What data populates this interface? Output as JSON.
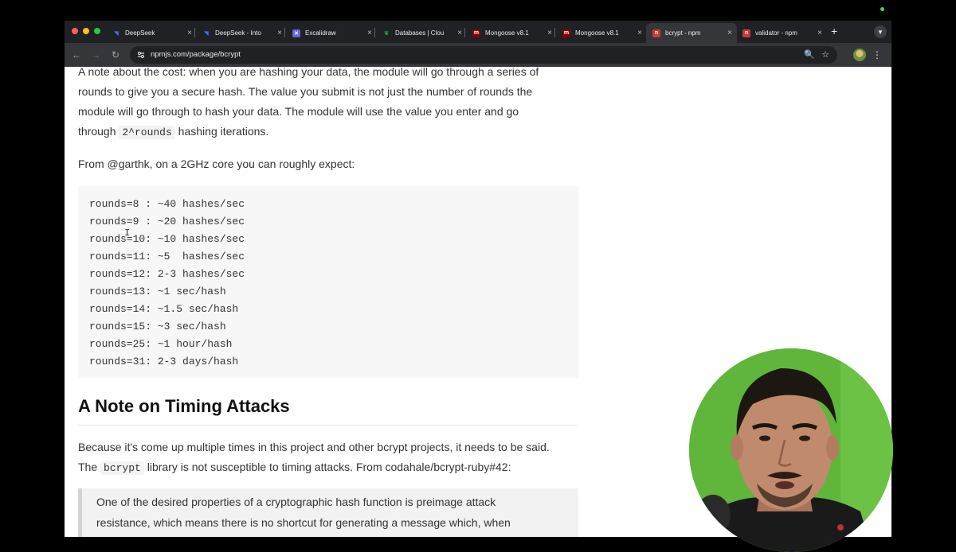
{
  "browser": {
    "tabs": [
      {
        "title": "DeepSeek",
        "icon": "deepseek-whale-icon",
        "color": "#4d6bfe",
        "active": false
      },
      {
        "title": "DeepSeek - Into",
        "icon": "deepseek-whale-icon",
        "color": "#4d6bfe",
        "active": false
      },
      {
        "title": "Excalidraw",
        "icon": "excalidraw-icon",
        "color": "#6965db",
        "active": false
      },
      {
        "title": "Databases | Clou",
        "icon": "mongodb-leaf-icon",
        "color": "#13aa52",
        "active": false
      },
      {
        "title": "Mongoose v8.1",
        "icon": "mongoose-icon",
        "color": "#800",
        "active": false
      },
      {
        "title": "Mongoose v8.1",
        "icon": "mongoose-icon",
        "color": "#800",
        "active": false
      },
      {
        "title": "bcrypt - npm",
        "icon": "npm-icon",
        "color": "#cb3837",
        "active": true
      },
      {
        "title": "validator - npm",
        "icon": "npm-icon",
        "color": "#cb3837",
        "active": false
      }
    ],
    "tab_close_glyph": "×",
    "new_tab_glyph": "+",
    "url": "npmjs.com/package/bcrypt"
  },
  "content": {
    "para1": {
      "line1": "A note about the cost: when you are hashing your data, the module will go through a series of",
      "line2": "rounds to give you a secure hash. The value you submit is not just the number of rounds the",
      "line3": "module will go through to hash your data. The module will use the value you enter and go",
      "line4_pre": "through ",
      "line4_code": "2^rounds",
      "line4_post": " hashing iterations."
    },
    "para2": "From @garthk, on a 2GHz core you can roughly expect:",
    "code_lines": [
      "rounds=8 : ~40 hashes/sec",
      "rounds=9 : ~20 hashes/sec",
      "rounds=10: ~10 hashes/sec",
      "rounds=11: ~5  hashes/sec",
      "rounds=12: 2-3 hashes/sec",
      "rounds=13: ~1 sec/hash",
      "rounds=14: ~1.5 sec/hash",
      "rounds=15: ~3 sec/hash",
      "rounds=25: ~1 hour/hash",
      "rounds=31: 2-3 days/hash"
    ],
    "heading": "A Note on Timing Attacks",
    "para3": {
      "line1": "Because it's come up multiple times in this project and other bcrypt projects, it needs to be said.",
      "line2_pre": "The ",
      "line2_code": "bcrypt",
      "line2_post": " library is not susceptible to timing attacks. From codahale/bcrypt-ruby#42:"
    },
    "quote": {
      "line1": "One of the desired properties of a cryptographic hash function is preimage attack",
      "line2": "resistance, which means there is no shortcut for generating a message which, when"
    }
  }
}
